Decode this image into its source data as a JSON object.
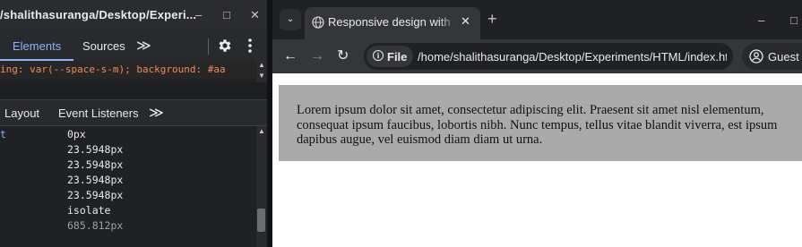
{
  "devtools": {
    "title": "/shalithasuranga/Desktop/Experi...",
    "tabs": {
      "elements": "Elements",
      "sources": "Sources",
      "more": "≫"
    },
    "css_line": "ing: var(--space-s-m); background: #aa",
    "subtabs": {
      "layout": "Layout",
      "event_listeners": "Event Listeners",
      "more": "≫"
    },
    "computed_rows": [
      {
        "prop": "t",
        "value": "0px"
      },
      {
        "prop": "",
        "value": "23.5948px"
      },
      {
        "prop": "",
        "value": "23.5948px"
      },
      {
        "prop": "",
        "value": "23.5948px"
      },
      {
        "prop": "",
        "value": "23.5948px"
      },
      {
        "prop": "",
        "value": "isolate"
      },
      {
        "prop": "",
        "value": "685.812px"
      }
    ],
    "window_controls": {
      "minimize": "–",
      "maximize": "□",
      "close": "✕"
    }
  },
  "browser": {
    "tab_search": "⌄",
    "tab_title": "Responsive design with C",
    "tab_close": "✕",
    "new_tab": "+",
    "window_controls": {
      "minimize": "–",
      "maximize": "□"
    },
    "nav": {
      "back": "←",
      "forward": "→",
      "reload": "↻"
    },
    "address": {
      "scheme_label": "File",
      "info_glyph": "i",
      "url": "/home/shalithasuranga/Desktop/Experiments/HTML/index.ht..."
    },
    "profile_label": "Guest",
    "page_text": "Lorem ipsum dolor sit amet, consectetur adipiscing elit. Praesent sit amet nisl elementum, consequat ipsum faucibus, lobortis nibh. Nunc tempus, tellus vitae blandit viverra, est ipsum dapibus augue, vel euismod diam diam ut urna."
  },
  "colors": {
    "devtools_bg": "#202124",
    "accent_blue": "#8ab4f8",
    "css_orange": "#f28b54",
    "page_box": "#aaaaaa",
    "page_bg": "#ffffff"
  }
}
